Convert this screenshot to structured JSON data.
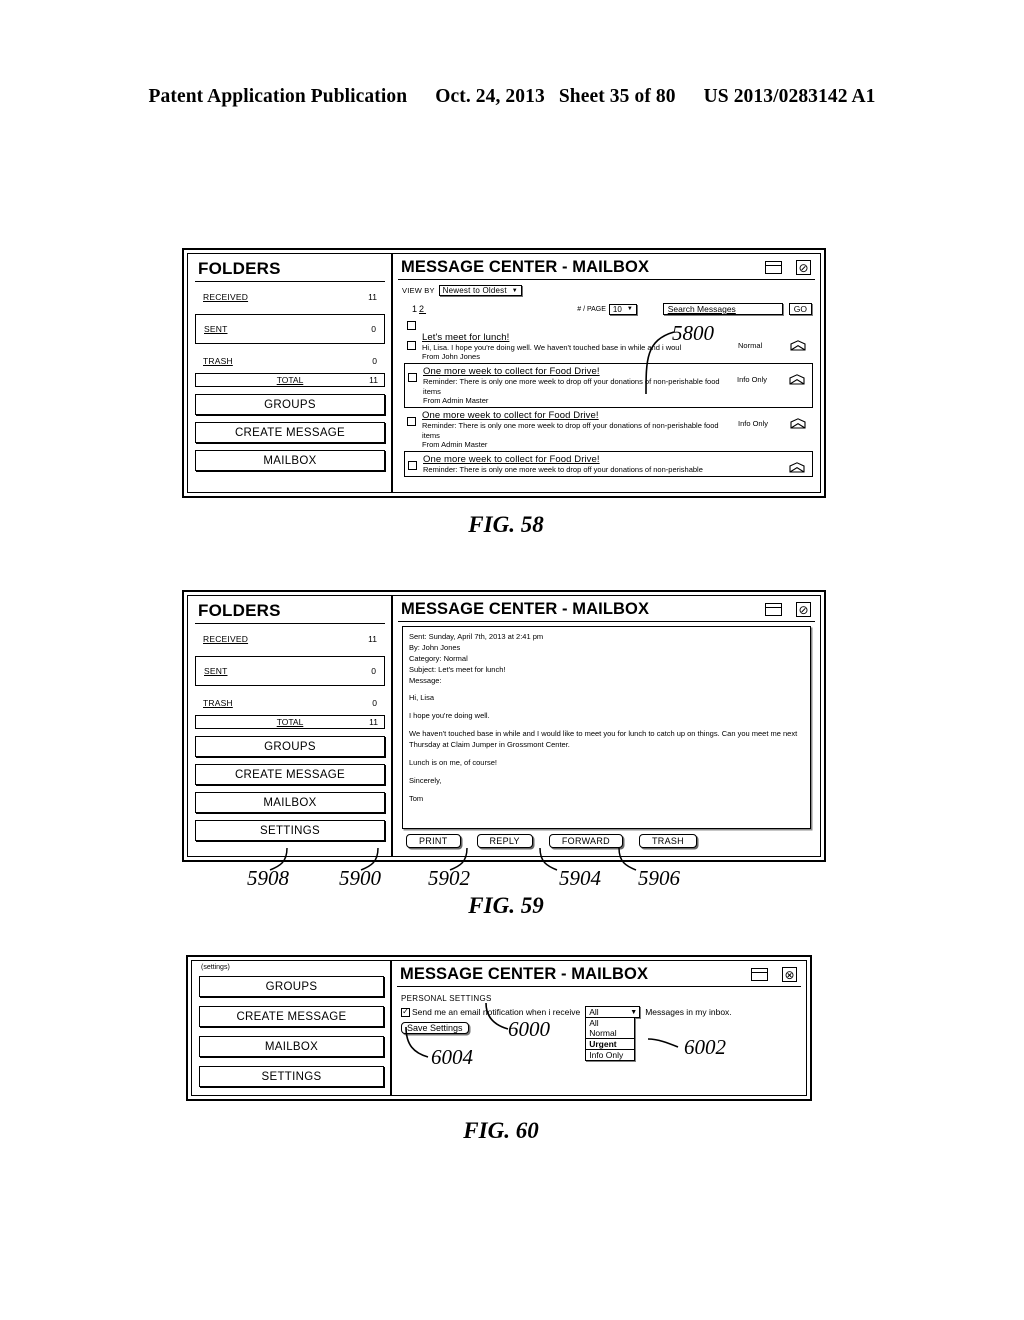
{
  "header": {
    "left": "Patent Application Publication",
    "date": "Oct. 24, 2013",
    "sheet": "Sheet 35 of 80",
    "docnum": "US 2013/0283142 A1"
  },
  "figures": {
    "fig58": {
      "caption": "FIG. 58",
      "ref": "5800",
      "sidebar": {
        "title": "FOLDERS",
        "folders": [
          {
            "label": "RECEIVED",
            "count": "11",
            "boxed": false
          },
          {
            "label": "SENT",
            "count": "0",
            "boxed": true
          },
          {
            "label": "TRASH",
            "count": "0",
            "boxed": false
          }
        ],
        "total": {
          "label": "TOTAL",
          "count": "11"
        },
        "buttons": [
          "GROUPS",
          "CREATE MESSAGE",
          "MAILBOX"
        ]
      },
      "titlebar": {
        "title": "MESSAGE CENTER - MAILBOX",
        "restore_icon": "restore-window-icon",
        "close_icon": "circle-slash-close-icon",
        "close_glyph": "⊘"
      },
      "toolbar": {
        "view_by_label": "VIEW BY",
        "view_by_value": "Newest to Oldest",
        "pager_current": "1",
        "pager_next": "2",
        "per_page_label": "# / PAGE",
        "per_page_value": "10",
        "search_placeholder": "Search Messages",
        "go_label": "GO"
      },
      "messages": [
        {
          "subject": "",
          "preview": "",
          "from": "",
          "category": "",
          "boxed": false,
          "empty": true
        },
        {
          "subject": "Let's meet for lunch!",
          "preview": "Hi, Lisa. I hope you're doing well. We haven't touched base in while and i woul",
          "from": "From John Jones",
          "category": "Normal",
          "boxed": false,
          "empty": false
        },
        {
          "subject": "One more week to collect for Food Drive!",
          "preview": "Reminder: There is only one more week to drop off your donations of non-perishable food items",
          "from": "From Admin Master",
          "category": "Info Only",
          "boxed": true,
          "empty": false
        },
        {
          "subject": "One more week to collect for Food Drive!",
          "preview": "Reminder: There is only one more week to drop off your donations of non-perishable food items",
          "from": "From Admin Master",
          "category": "Info Only",
          "boxed": false,
          "empty": false
        },
        {
          "subject": "One more week to collect for Food Drive!",
          "preview": "Reminder: There is only one more week to drop off your donations of non-perishable",
          "from": "",
          "category": "",
          "boxed": true,
          "empty": false
        }
      ]
    },
    "fig59": {
      "caption": "FIG. 59",
      "refs": [
        "5908",
        "5900",
        "5902",
        "5904",
        "5906"
      ],
      "sidebar": {
        "title": "FOLDERS",
        "folders": [
          {
            "label": "RECEIVED",
            "count": "11",
            "boxed": false
          },
          {
            "label": "SENT",
            "count": "0",
            "boxed": true
          },
          {
            "label": "TRASH",
            "count": "0",
            "boxed": false
          }
        ],
        "total": {
          "label": "TOTAL",
          "count": "11"
        },
        "buttons": [
          "GROUPS",
          "CREATE MESSAGE",
          "MAILBOX",
          "SETTINGS"
        ]
      },
      "titlebar": {
        "title": "MESSAGE CENTER - MAILBOX",
        "restore_icon": "restore-window-icon",
        "close_icon": "circle-slash-close-icon",
        "close_glyph": "⊘"
      },
      "detail": {
        "sent": "Sent: Sunday, April 7th, 2013 at 2:41 pm",
        "by": "By: John Jones",
        "category": "Category: Normal",
        "subject": "Subject: Let's meet for lunch!",
        "message_label": "Message:",
        "greeting": "Hi, Lisa",
        "line1": "I hope you're doing well.",
        "line2": "We haven't touched base in while and I would like to meet you for lunch to catch up on things.  Can you meet me next Thursday at Claim Jumper in Grossmont Center.",
        "line3": "Lunch is on me, of course!",
        "closing": "Sincerely,",
        "signature": "Tom"
      },
      "actions": [
        "PRINT",
        "REPLY",
        "FORWARD",
        "TRASH"
      ]
    },
    "fig60": {
      "caption": "FIG. 60",
      "refs": {
        "checkbox": "6000",
        "dropdown": "6002",
        "save": "6004"
      },
      "sidebar": {
        "tag": "(settings)",
        "buttons": [
          "GROUPS",
          "CREATE MESSAGE",
          "MAILBOX",
          "SETTINGS"
        ]
      },
      "titlebar": {
        "title": "MESSAGE CENTER - MAILBOX",
        "restore_icon": "restore-window-icon",
        "close_icon": "circle-x-close-icon",
        "close_glyph": "⊗"
      },
      "settings": {
        "heading": "PERSONAL SETTINGS",
        "checkbox_checked": true,
        "check_glyph": "✓",
        "text_before": "Send me an email notification when i receive",
        "select_value": "All",
        "select_options": [
          "All",
          "Normal",
          "Urgent",
          "Info Only"
        ],
        "select_highlighted": "Urgent",
        "text_after": "Messages in my inbox.",
        "save_label": "Save Settings"
      }
    }
  }
}
